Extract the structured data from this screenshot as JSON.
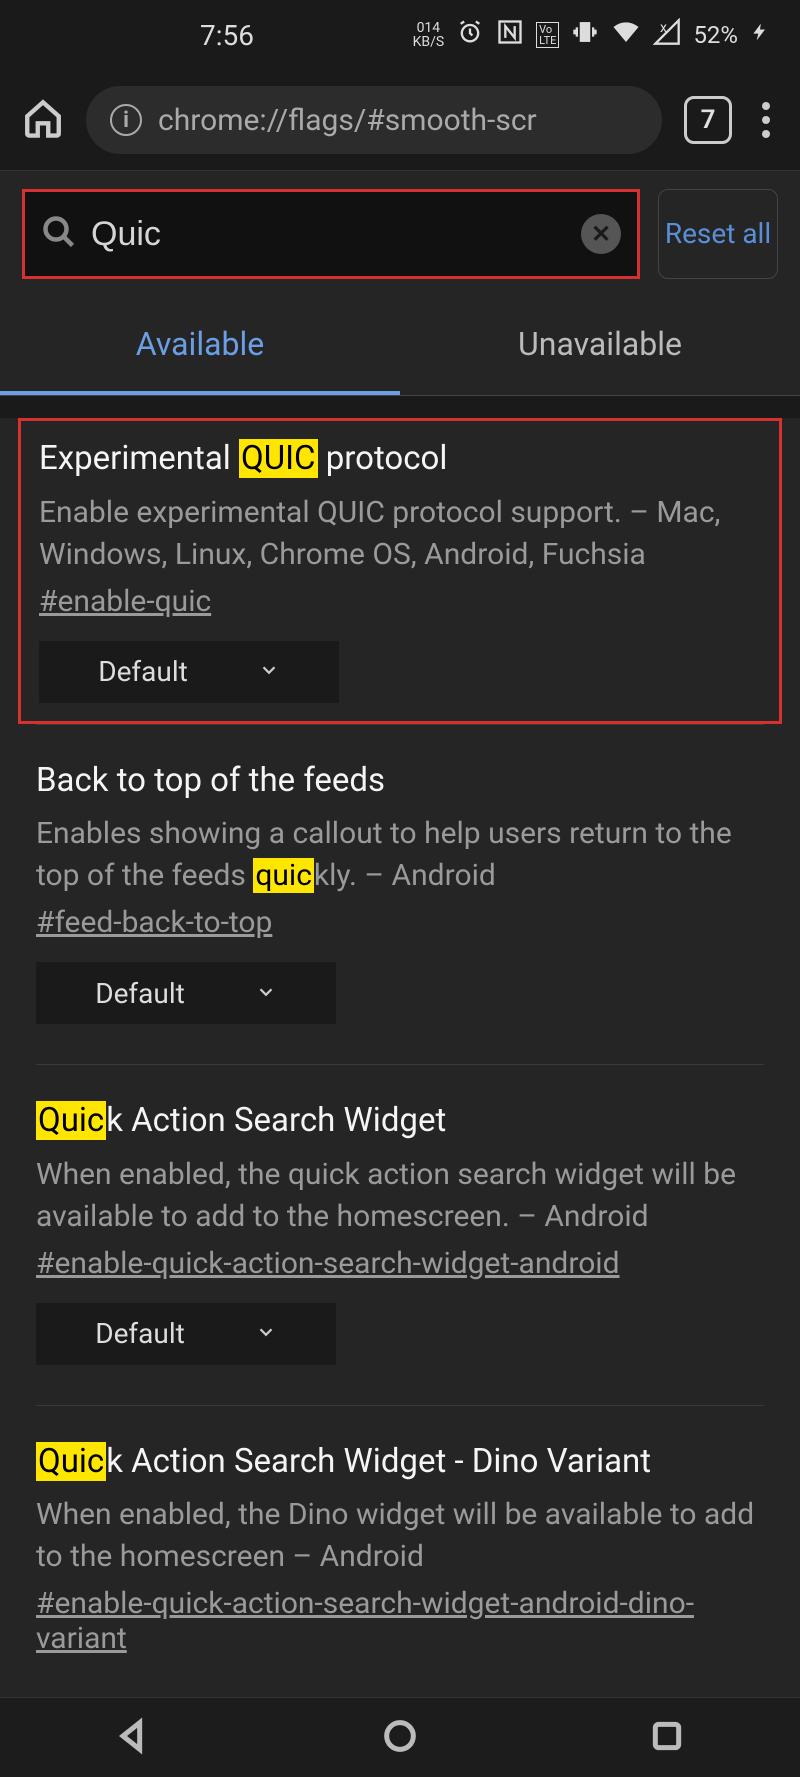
{
  "status": {
    "time": "7:56",
    "kbps_value": "014",
    "kbps_label": "KB/S",
    "volte": "VoLTE",
    "battery": "52%"
  },
  "toolbar": {
    "url": "chrome://flags/#smooth-scr",
    "tab_count": "7"
  },
  "search": {
    "value": "Quic",
    "reset_label": "Reset all"
  },
  "tabs": {
    "available": "Available",
    "unavailable": "Unavailable"
  },
  "flags": [
    {
      "title_pre": "Experimental ",
      "title_hl": "QUIC",
      "title_post": " protocol",
      "desc_pre": "Enable experimental QUIC protocol support. – Mac, Windows, Linux, Chrome OS, Android, Fuchsia",
      "desc_hl": "",
      "desc_post": "",
      "hash": "#enable-quic",
      "dropdown": "Default"
    },
    {
      "title_pre": "Back to top of the feeds",
      "title_hl": "",
      "title_post": "",
      "desc_pre": "Enables showing a callout to help users return to the top of the feeds ",
      "desc_hl": "quic",
      "desc_post": "kly. – Android",
      "hash": "#feed-back-to-top",
      "dropdown": "Default"
    },
    {
      "title_pre": "",
      "title_hl": "Quic",
      "title_post": "k Action Search Widget",
      "desc_pre": "When enabled, the quick action search widget will be available to add to the homescreen. – Android",
      "desc_hl": "",
      "desc_post": "",
      "hash": "#enable-quick-action-search-widget-android",
      "dropdown": "Default"
    },
    {
      "title_pre": "",
      "title_hl": "Quic",
      "title_post": "k Action Search Widget - Dino Variant",
      "desc_pre": "When enabled, the Dino widget will be available to add to the homescreen – Android",
      "desc_hl": "",
      "desc_post": "",
      "hash": "#enable-quick-action-search-widget-android-dino-variant",
      "dropdown": "Default"
    }
  ]
}
